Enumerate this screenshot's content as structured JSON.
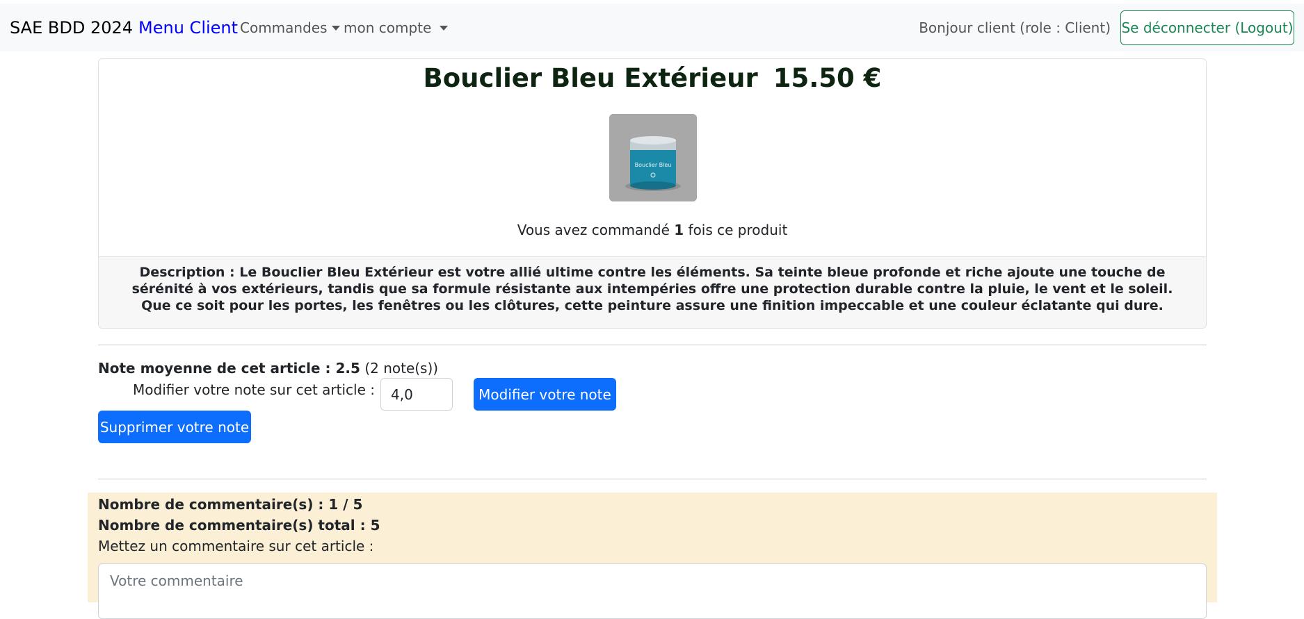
{
  "navbar": {
    "brand": "SAE BDD 2024",
    "brand_accent": "Menu Client",
    "menus": [
      "Commandes",
      "mon compte"
    ],
    "greeting": "Bonjour client (role : Client)",
    "logout_label": "Se déconnecter (Logout)"
  },
  "product": {
    "name": "Bouclier Bleu Extérieur",
    "price": "15.50 €",
    "image_label": "Bouclier Bleu",
    "ordered_prefix": "Vous avez commandé",
    "ordered_count": "1",
    "ordered_suffix": "fois ce produit",
    "description": "Description : Le Bouclier Bleu Extérieur est votre allié ultime contre les éléments. Sa teinte bleue profonde et riche ajoute une touche de sérénité à vos extérieurs, tandis que sa formule résistante aux intempéries offre une protection durable contre la pluie, le vent et le soleil. Que ce soit pour les portes, les fenêtres ou les clôtures, cette peinture assure une finition impeccable et une couleur éclatante qui dure."
  },
  "rating": {
    "average_label": "Note moyenne de cet article : 2.5",
    "count_label": "(2 note(s))",
    "modify_label": "Modifier votre note sur cet article :",
    "current_value": "4,0",
    "modify_button": "Modifier votre note",
    "delete_button": "Supprimer votre note"
  },
  "comments": {
    "count_label": "Nombre de commentaire(s) : 1 / 5",
    "total_label": "Nombre de commentaire(s) total : 5",
    "prompt": "Mettez un commentaire sur cet article :",
    "placeholder": "Votre commentaire"
  },
  "colors": {
    "primary": "#0d6efd",
    "success": "#198754",
    "brand_accent": "#0000ff",
    "comments_bg": "#fbf0d6"
  }
}
